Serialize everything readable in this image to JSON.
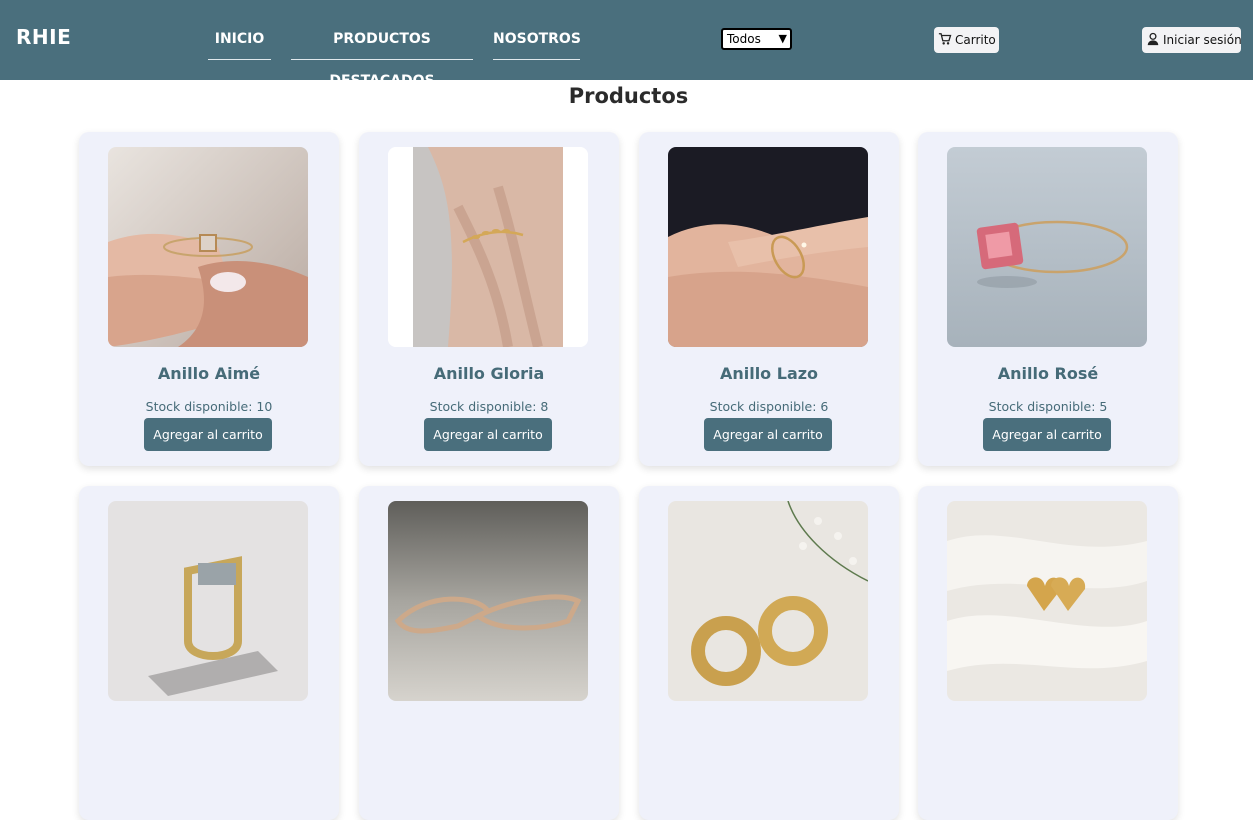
{
  "header": {
    "logo": "RHIE",
    "nav": [
      "INICIO",
      "PRODUCTOS DESTACADOS",
      "NOSOTROS"
    ],
    "filter": {
      "selected": "Todos"
    },
    "cart_label": "Carrito",
    "login_label": "Iniciar sesión"
  },
  "main": {
    "title": "Productos",
    "products": [
      {
        "name": "Anillo Aimé",
        "stock": "Stock disponible: 10",
        "button": "Agregar al carrito"
      },
      {
        "name": "Anillo Gloria",
        "stock": "Stock disponible: 8",
        "button": "Agregar al carrito"
      },
      {
        "name": "Anillo Lazo",
        "stock": "Stock disponible: 6",
        "button": "Agregar al carrito"
      },
      {
        "name": "Anillo Rosé",
        "stock": "Stock disponible: 5",
        "button": "Agregar al carrito"
      }
    ]
  },
  "colors": {
    "header_bg": "#4a6f7d",
    "card_bg": "#eff1fa",
    "accent_text": "#466b78"
  }
}
